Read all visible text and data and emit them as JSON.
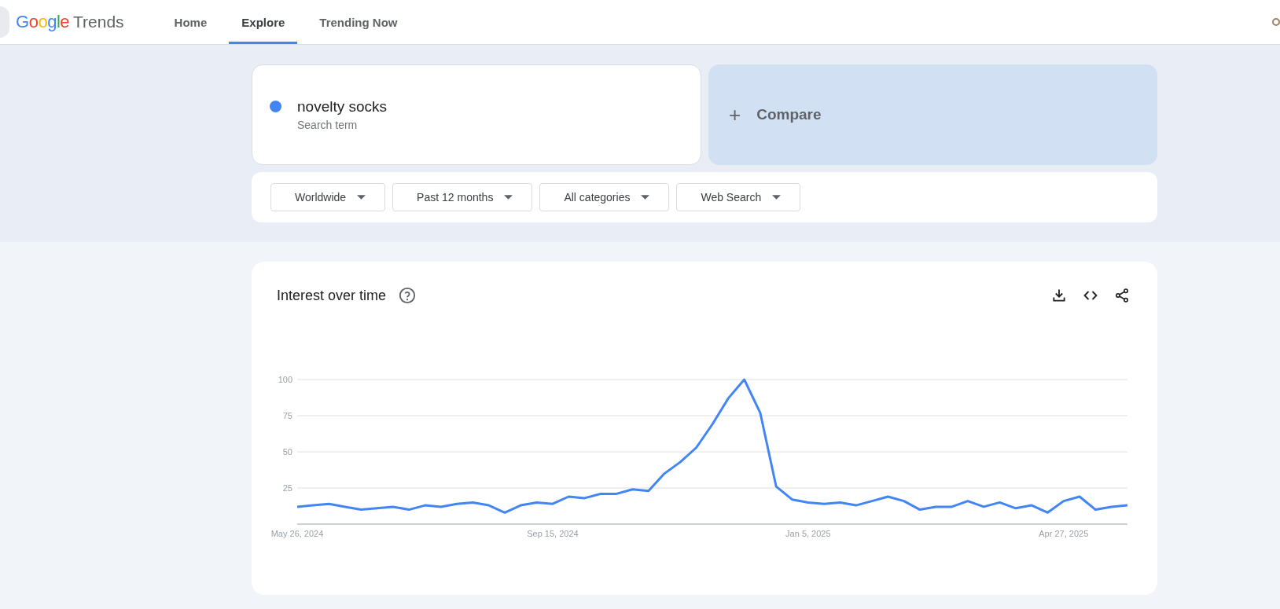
{
  "header": {
    "logo": {
      "brand": "Google",
      "product": "Trends"
    },
    "nav": [
      {
        "label": "Home",
        "selected": false
      },
      {
        "label": "Explore",
        "selected": true
      },
      {
        "label": "Trending Now",
        "selected": false
      }
    ]
  },
  "search": {
    "term": "novelty socks",
    "term_type": "Search term",
    "color": "#4285f4",
    "compare": {
      "icon": "+",
      "label": "Compare"
    }
  },
  "filters": [
    {
      "label": "Worldwide"
    },
    {
      "label": "Past 12 months"
    },
    {
      "label": "All categories"
    },
    {
      "label": "Web Search"
    }
  ],
  "interest_over_time": {
    "title": "Interest over time",
    "chart_data": {
      "type": "line",
      "grid": true,
      "ylim": [
        0,
        100
      ],
      "yticks": [
        25,
        50,
        75,
        100
      ],
      "categories": [
        "May 26, 2024",
        null,
        null,
        null,
        null,
        null,
        null,
        null,
        null,
        null,
        null,
        null,
        null,
        null,
        null,
        null,
        "Sep 15, 2024",
        null,
        null,
        null,
        null,
        null,
        null,
        null,
        null,
        null,
        null,
        null,
        null,
        null,
        null,
        null,
        "Jan 5, 2025",
        null,
        null,
        null,
        null,
        null,
        null,
        null,
        null,
        null,
        null,
        null,
        null,
        null,
        null,
        null,
        "Apr 27, 2025",
        null,
        null,
        null,
        null
      ],
      "series": [
        {
          "color": "#4285f4",
          "values": [
            12,
            13,
            14,
            12,
            10,
            11,
            12,
            10,
            13,
            12,
            14,
            15,
            13,
            8,
            13,
            15,
            14,
            19,
            18,
            21,
            21,
            24,
            23,
            35,
            43,
            53,
            69,
            87,
            100,
            77,
            26,
            17,
            15,
            14,
            15,
            13,
            16,
            19,
            16,
            10,
            12,
            12,
            16,
            12,
            15,
            11,
            13,
            8,
            16,
            19,
            10,
            12,
            13
          ]
        }
      ]
    }
  }
}
